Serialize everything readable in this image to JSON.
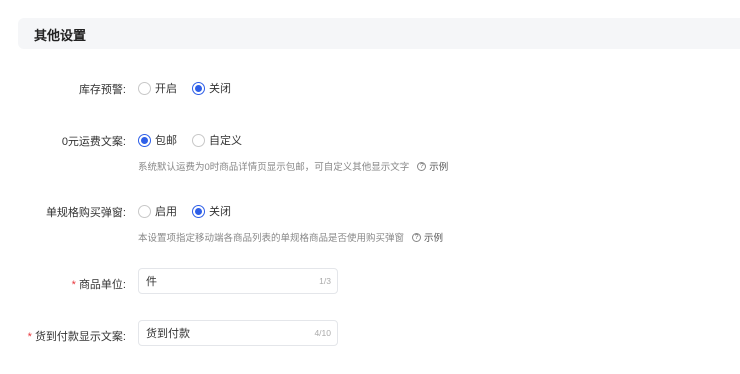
{
  "section": {
    "title": "其他设置"
  },
  "stock_alert": {
    "label": "库存预警:",
    "options": [
      {
        "label": "开启",
        "checked": false
      },
      {
        "label": "关闭",
        "checked": true
      }
    ]
  },
  "zero_shipping": {
    "label": "0元运费文案:",
    "options": [
      {
        "label": "包邮",
        "checked": true
      },
      {
        "label": "自定义",
        "checked": false
      }
    ],
    "help": "系统默认运费为0时商品详情页显示包邮，可自定义其他显示文字",
    "help_link": "示例"
  },
  "single_spec_popup": {
    "label": "单规格购买弹窗:",
    "options": [
      {
        "label": "启用",
        "checked": false
      },
      {
        "label": "关闭",
        "checked": true
      }
    ],
    "help": "本设置项指定移动端各商品列表的单规格商品是否使用购买弹窗",
    "help_link": "示例"
  },
  "product_unit": {
    "required_mark": "*",
    "label": "商品单位:",
    "value": "件",
    "counter": "1/3"
  },
  "cod_text": {
    "required_mark": "*",
    "label": "货到付款显示文案:",
    "value": "货到付款",
    "counter": "4/10"
  },
  "colors": {
    "accent": "#2e5fe8",
    "required": "#e8363c",
    "header_bg": "#f5f6f8"
  },
  "icons": {
    "help": "question-circle-icon"
  }
}
